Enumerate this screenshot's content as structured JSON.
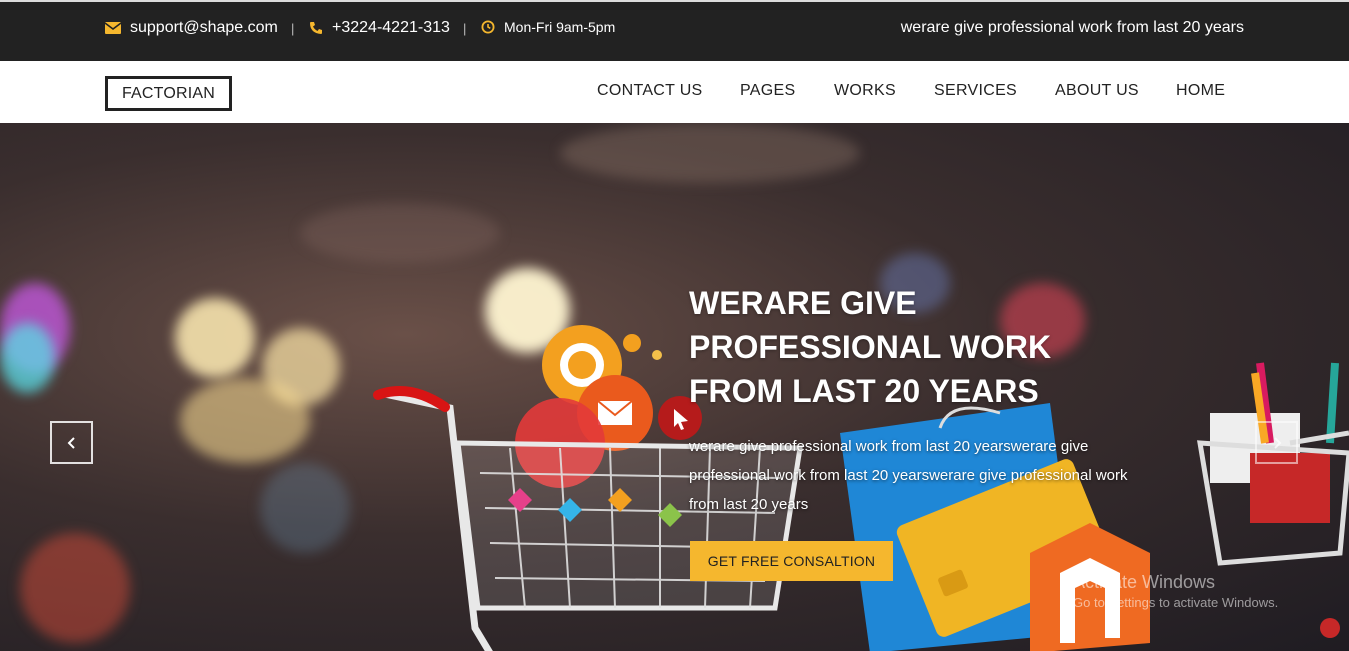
{
  "topbar": {
    "email": "support@shape.com",
    "phone": "+3224-4221-313",
    "hours": "Mon-Fri 9am-5pm",
    "separator": "|",
    "tagline": "werare give professional work from last 20 years",
    "accent_color": "#f5b72e",
    "icons": [
      "envelope-icon",
      "phone-icon",
      "clock-icon"
    ]
  },
  "nav": {
    "logo": "FACTORIAN",
    "links": [
      "CONTACT US",
      "PAGES",
      "WORKS",
      "SERVICES",
      "ABOUT US",
      "HOME"
    ]
  },
  "hero": {
    "title": "WERARE GIVE PROFESSIONAL WORK FROM LAST 20 YEARS",
    "text": "werare give professional work from last 20 yearswerare give professional work from last 20 yearswerare give professional work from last 20 years",
    "cta": "GET FREE CONSALTION",
    "cta_color": "#f5b72e",
    "prev_icon": "chevron-left-icon",
    "next_icon": "chevron-right-icon"
  },
  "watermark": {
    "line1": "Activate Windows",
    "line2": "Go to Settings to activate Windows."
  }
}
